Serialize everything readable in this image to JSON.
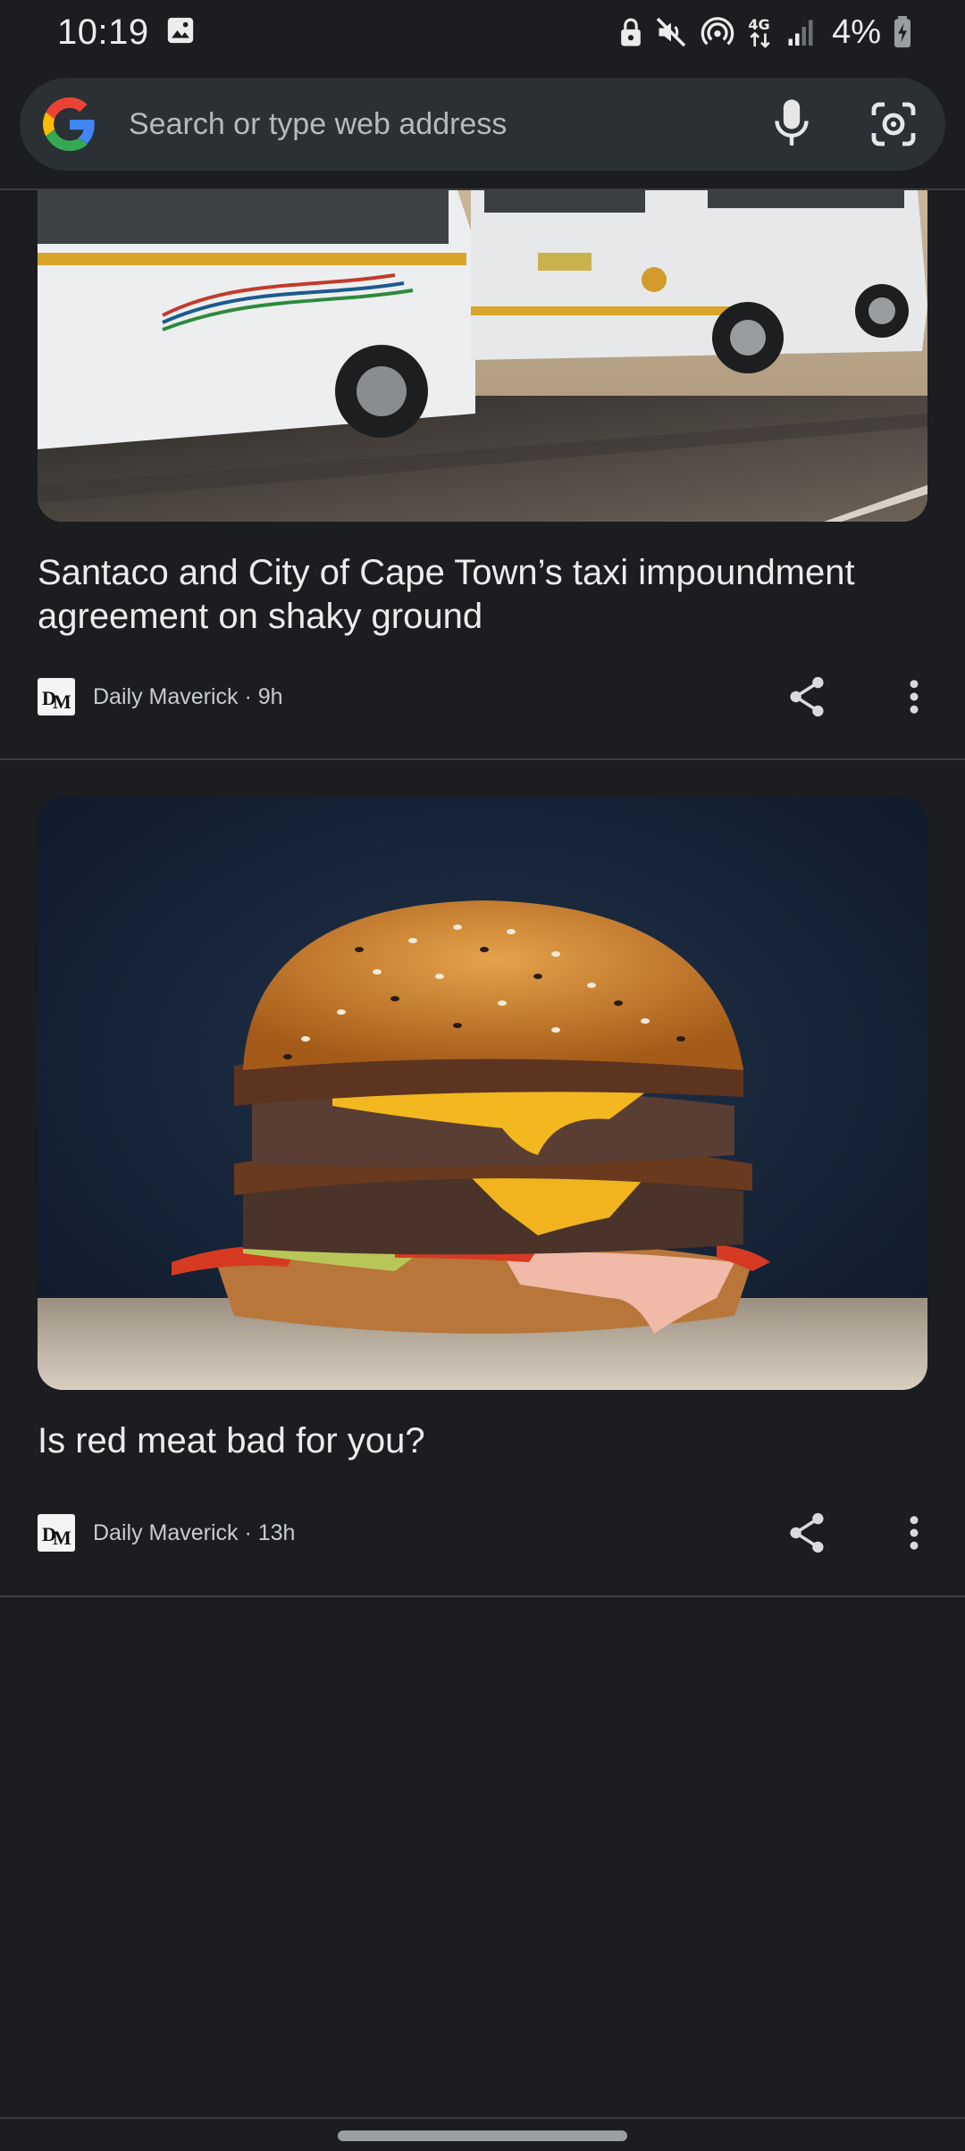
{
  "status_bar": {
    "time": "10:19",
    "battery": "4%",
    "network": "4G",
    "icons": [
      "image-icon",
      "lock-app-icon",
      "mute-icon",
      "hotspot-icon",
      "network-4g-icon",
      "signal-icon",
      "battery-icon"
    ]
  },
  "search": {
    "placeholder": "Search or type web address",
    "icons": [
      "google-logo",
      "mic-icon",
      "lens-icon"
    ]
  },
  "feed": {
    "articles": [
      {
        "title": "Santaco and City of Cape Town’s taxi impoundment agreement on shaky ground",
        "publisher": "Daily Maverick",
        "age": "9h",
        "meta": "Daily Maverick · 9h",
        "image": "white-minibus-taxis-photo"
      },
      {
        "title": "Is red meat bad for you?",
        "publisher": "Daily Maverick",
        "age": "13h",
        "meta": "Daily Maverick · 13h",
        "image": "cheeseburger-photo"
      }
    ]
  },
  "colors": {
    "background": "#1b1d20",
    "search_bar": "#2a3033",
    "text_primary": "#ececec",
    "text_secondary": "#c8cbce"
  }
}
